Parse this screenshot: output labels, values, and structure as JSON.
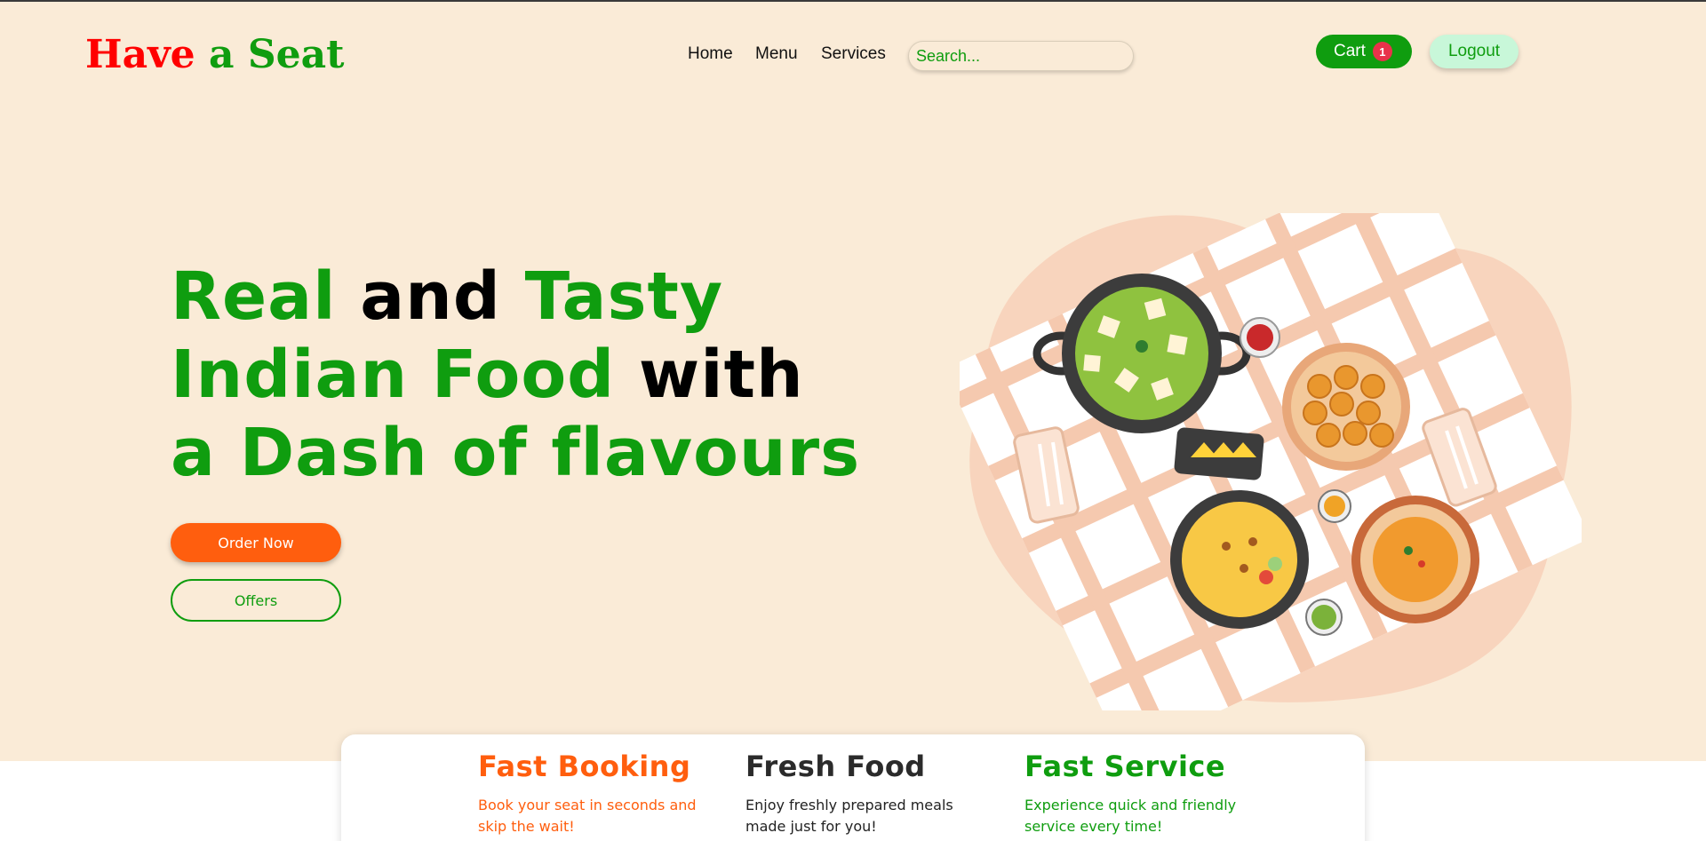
{
  "brand": {
    "part1": "Have",
    "part2": "a Seat"
  },
  "nav": {
    "home": "Home",
    "menu": "Menu",
    "services": "Services"
  },
  "search": {
    "placeholder": "Search..."
  },
  "cart": {
    "label": "Cart",
    "count": "1"
  },
  "logout": {
    "label": "Logout"
  },
  "hero": {
    "line1_a": "Real",
    "line1_b": "and",
    "line1_c": "Tasty",
    "line2_a": "Indian Food",
    "line2_b": "with",
    "line3": "a Dash of flavours",
    "order_label": "Order Now",
    "offers_label": "Offers"
  },
  "features": [
    {
      "title": "Fast Booking",
      "desc": "Book your seat in seconds and skip the wait!"
    },
    {
      "title": "Fresh Food",
      "desc": "Enjoy freshly prepared meals made just for you!"
    },
    {
      "title": "Fast Service",
      "desc": "Experience quick and friendly service every time!"
    }
  ],
  "colors": {
    "brand_green": "#0f9d0f",
    "brand_red": "#ff0000",
    "accent_orange": "#ff5e0e",
    "hero_bg": "#faebd7"
  }
}
